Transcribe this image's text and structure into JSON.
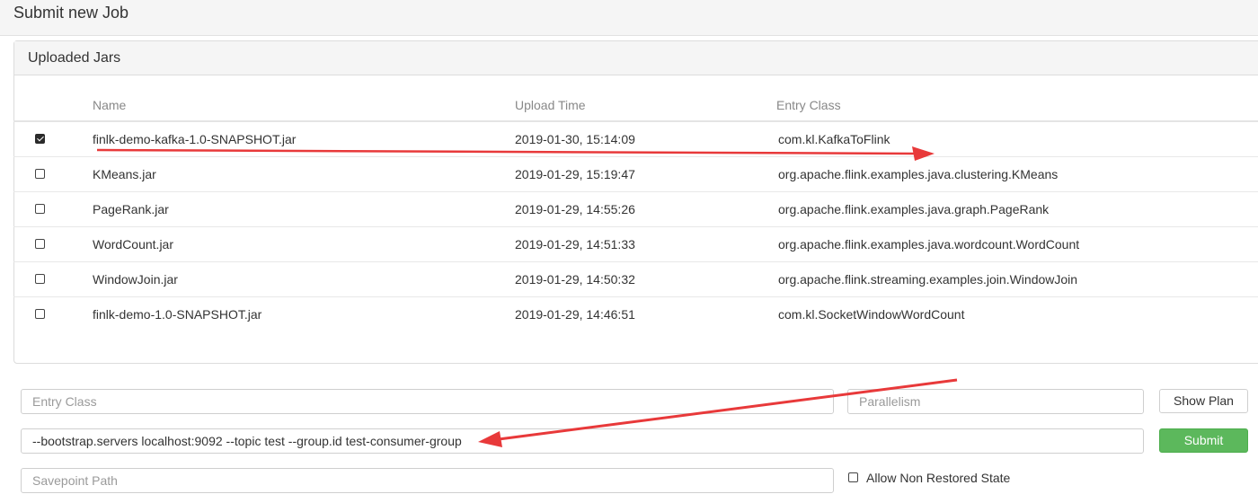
{
  "header": {
    "title": "Submit new Job"
  },
  "jars_panel": {
    "title": "Uploaded Jars",
    "columns": [
      "Name",
      "Upload Time",
      "Entry Class"
    ],
    "rows": [
      {
        "checked": true,
        "name": "finlk-demo-kafka-1.0-SNAPSHOT.jar",
        "upload_time": "2019-01-30, 15:14:09",
        "entry_class": "com.kl.KafkaToFlink"
      },
      {
        "checked": false,
        "name": "KMeans.jar",
        "upload_time": "2019-01-29, 15:19:47",
        "entry_class": "org.apache.flink.examples.java.clustering.KMeans"
      },
      {
        "checked": false,
        "name": "PageRank.jar",
        "upload_time": "2019-01-29, 14:55:26",
        "entry_class": "org.apache.flink.examples.java.graph.PageRank"
      },
      {
        "checked": false,
        "name": "WordCount.jar",
        "upload_time": "2019-01-29, 14:51:33",
        "entry_class": "org.apache.flink.examples.java.wordcount.WordCount"
      },
      {
        "checked": false,
        "name": "WindowJoin.jar",
        "upload_time": "2019-01-29, 14:50:32",
        "entry_class": "org.apache.flink.streaming.examples.join.WindowJoin"
      },
      {
        "checked": false,
        "name": "finlk-demo-1.0-SNAPSHOT.jar",
        "upload_time": "2019-01-29, 14:46:51",
        "entry_class": "com.kl.SocketWindowWordCount"
      }
    ]
  },
  "form": {
    "entry_class": {
      "placeholder": "Entry Class",
      "value": ""
    },
    "parallelism": {
      "placeholder": "Parallelism",
      "value": ""
    },
    "program_args": {
      "placeholder": "",
      "value": "--bootstrap.servers localhost:9092 --topic test --group.id test-consumer-group"
    },
    "savepoint_path": {
      "placeholder": "Savepoint Path",
      "value": ""
    },
    "show_plan_label": "Show Plan",
    "submit_label": "Submit",
    "allow_non_restored_label": "Allow Non Restored State",
    "allow_non_restored_checked": false
  },
  "annotation": {
    "arrow_color": "#e8393a"
  }
}
